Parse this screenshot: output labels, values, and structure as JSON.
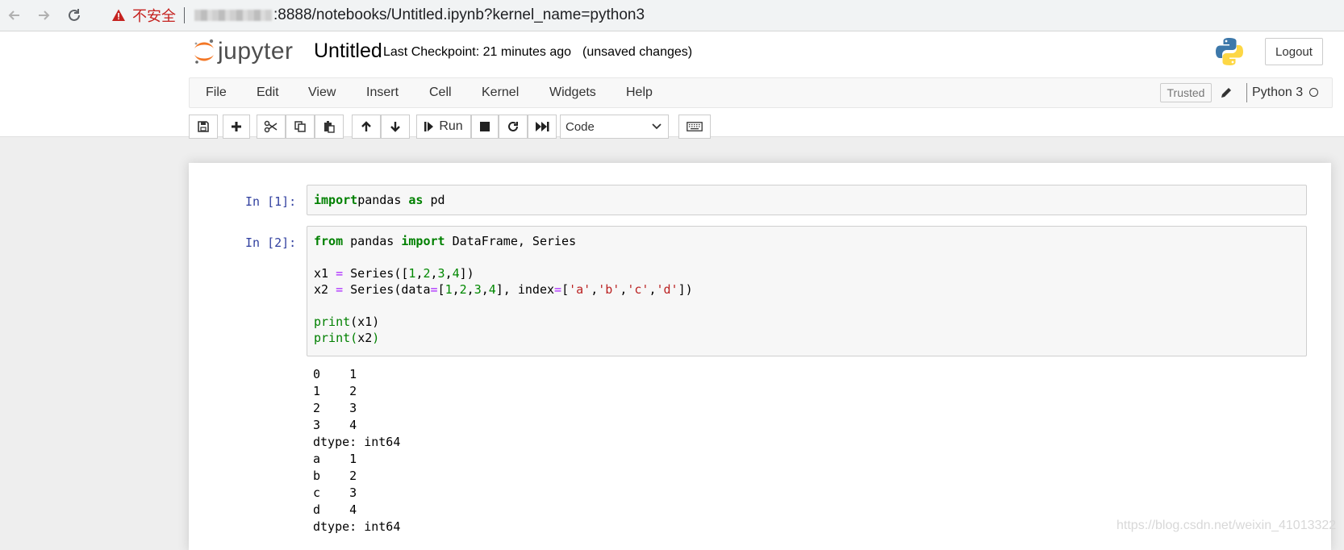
{
  "browser": {
    "security_label": "不安全",
    "url_visible": ":8888/notebooks/Untitled.ipynb?kernel_name=python3"
  },
  "header": {
    "logo_text": "jupyter",
    "notebook_title": "Untitled",
    "checkpoint_text": "Last Checkpoint: 21 minutes ago",
    "unsaved_text": "(unsaved changes)",
    "logout_label": "Logout"
  },
  "menubar": {
    "items": [
      "File",
      "Edit",
      "View",
      "Insert",
      "Cell",
      "Kernel",
      "Widgets",
      "Help"
    ],
    "trusted_label": "Trusted",
    "kernel_name": "Python 3"
  },
  "toolbar": {
    "run_label": "Run",
    "cell_type": "Code"
  },
  "cells": [
    {
      "prompt": "In  [1]:",
      "lines": [
        [
          [
            "kw",
            "import"
          ],
          [
            "",
            "pandas "
          ],
          [
            "kw",
            "as"
          ],
          [
            "",
            " pd"
          ]
        ]
      ]
    },
    {
      "prompt": "In  [2]:",
      "lines": [
        [
          [
            "kw",
            "from"
          ],
          [
            "",
            " pandas "
          ],
          [
            "kw",
            "import"
          ],
          [
            "",
            " DataFrame, Series"
          ]
        ],
        [],
        [
          [
            "",
            "x1 "
          ],
          [
            "op",
            "="
          ],
          [
            "",
            " Series(["
          ],
          [
            "num",
            "1"
          ],
          [
            "",
            ","
          ],
          [
            "num",
            "2"
          ],
          [
            "",
            ","
          ],
          [
            "num",
            "3"
          ],
          [
            "",
            ","
          ],
          [
            "num",
            "4"
          ],
          [
            "",
            "])"
          ]
        ],
        [
          [
            "",
            "x2 "
          ],
          [
            "op",
            "="
          ],
          [
            "",
            " Series(data"
          ],
          [
            "op",
            "="
          ],
          [
            "",
            "["
          ],
          [
            "num",
            "1"
          ],
          [
            "",
            ","
          ],
          [
            "num",
            "2"
          ],
          [
            "",
            ","
          ],
          [
            "num",
            "3"
          ],
          [
            "",
            ","
          ],
          [
            "num",
            "4"
          ],
          [
            "",
            "], index"
          ],
          [
            "op",
            "="
          ],
          [
            "",
            "["
          ],
          [
            "str",
            "'a'"
          ],
          [
            "",
            ","
          ],
          [
            "str",
            "'b'"
          ],
          [
            "",
            ","
          ],
          [
            "str",
            "'c'"
          ],
          [
            "",
            ","
          ],
          [
            "str",
            "'d'"
          ],
          [
            "",
            "])"
          ]
        ],
        [],
        [
          [
            "bi",
            "print"
          ],
          [
            "",
            "(x1)"
          ]
        ],
        [
          [
            "bi",
            "print"
          ],
          [
            "bi",
            "("
          ],
          [
            "",
            "x2"
          ],
          [
            "bi",
            ")"
          ]
        ]
      ],
      "output": [
        "0    1",
        "1    2",
        "2    3",
        "3    4",
        "dtype: int64",
        "a    1",
        "b    2",
        "c    3",
        "d    4",
        "dtype: int64"
      ]
    }
  ],
  "watermark": "https://blog.csdn.net/weixin_41013322"
}
